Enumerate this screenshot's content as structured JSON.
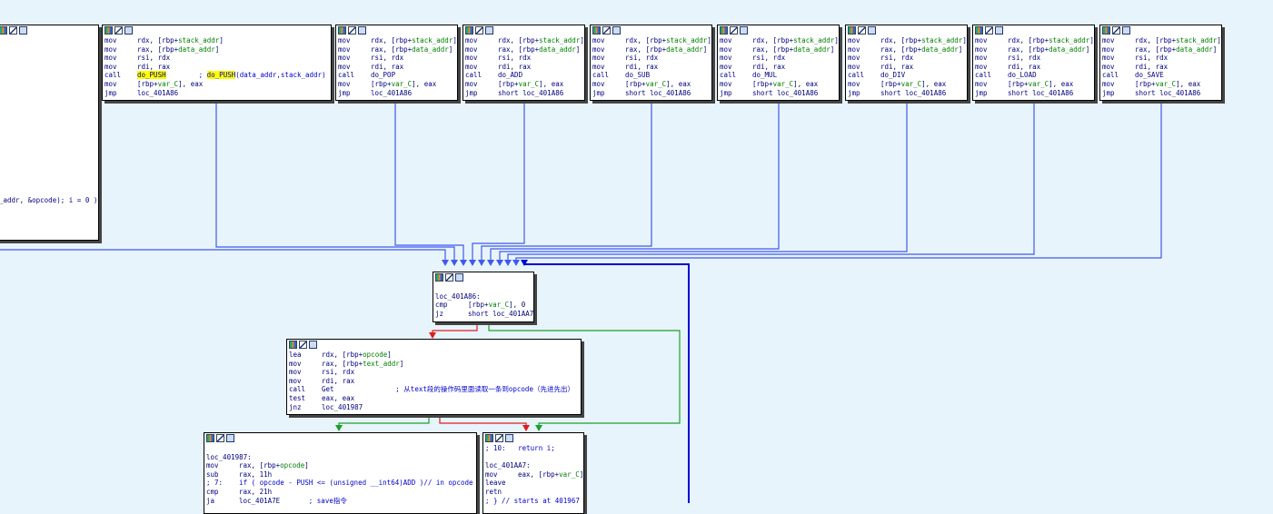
{
  "colors": {
    "background": "#e8f4fb",
    "edge_blue": "#3f59ee",
    "edge_dark_blue": "#0000d8",
    "edge_red": "#e01c1c",
    "edge_green": "#1aa02a",
    "highlight": "#ffff00"
  },
  "toolbar_icons": [
    "graph-overview-icon",
    "edit-node-icon",
    "rename-node-icon"
  ],
  "nodes": {
    "partial": {
      "lines": [
        {
          "text": "_addr, &opcode); i = 0 )"
        }
      ]
    },
    "push": {
      "lines": [
        {
          "m": "mov",
          "o": "rdx, [rbp+",
          "g": "stack_addr",
          "t": "]"
        },
        {
          "m": "mov",
          "o": "rax, [rbp+",
          "g": "data_addr",
          "t": "]"
        },
        {
          "m": "mov",
          "o": "rsi, rdx"
        },
        {
          "m": "mov",
          "o": "rdi, rax"
        },
        {
          "m": "call",
          "o": "",
          "h": "do_PUSH",
          "c": "; do_PUSH(data_addr,stack_addr)",
          "ch": "do_PUSH"
        },
        {
          "m": "mov",
          "o": "[rbp+",
          "g": "var_C",
          "t": "], eax"
        },
        {
          "m": "jmp",
          "o": "loc_401A86"
        }
      ]
    },
    "pop": {
      "lines": [
        {
          "m": "mov",
          "o": "rdx, [rbp+",
          "g": "stack_addr",
          "t": "]"
        },
        {
          "m": "mov",
          "o": "rax, [rbp+",
          "g": "data_addr",
          "t": "]"
        },
        {
          "m": "mov",
          "o": "rsi, rdx"
        },
        {
          "m": "mov",
          "o": "rdi, rax"
        },
        {
          "m": "call",
          "o": "do_POP"
        },
        {
          "m": "mov",
          "o": "[rbp+",
          "g": "var_C",
          "t": "], eax"
        },
        {
          "m": "jmp",
          "o": "loc_401A86"
        }
      ]
    },
    "add": {
      "lines": [
        {
          "m": "mov",
          "o": "rdx, [rbp+",
          "g": "stack_addr",
          "t": "]"
        },
        {
          "m": "mov",
          "o": "rax, [rbp+",
          "g": "data_addr",
          "t": "]"
        },
        {
          "m": "mov",
          "o": "rsi, rdx"
        },
        {
          "m": "mov",
          "o": "rdi, rax"
        },
        {
          "m": "call",
          "o": "do_ADD"
        },
        {
          "m": "mov",
          "o": "[rbp+",
          "g": "var_C",
          "t": "], eax"
        },
        {
          "m": "jmp",
          "o": "short loc_401A86"
        }
      ]
    },
    "sub": {
      "lines": [
        {
          "m": "mov",
          "o": "rdx, [rbp+",
          "g": "stack_addr",
          "t": "]"
        },
        {
          "m": "mov",
          "o": "rax, [rbp+",
          "g": "data_addr",
          "t": "]"
        },
        {
          "m": "mov",
          "o": "rsi, rdx"
        },
        {
          "m": "mov",
          "o": "rdi, rax"
        },
        {
          "m": "call",
          "o": "do_SUB"
        },
        {
          "m": "mov",
          "o": "[rbp+",
          "g": "var_C",
          "t": "], eax"
        },
        {
          "m": "jmp",
          "o": "short loc_401A86"
        }
      ]
    },
    "mul": {
      "lines": [
        {
          "m": "mov",
          "o": "rdx, [rbp+",
          "g": "stack_addr",
          "t": "]"
        },
        {
          "m": "mov",
          "o": "rax, [rbp+",
          "g": "data_addr",
          "t": "]"
        },
        {
          "m": "mov",
          "o": "rsi, rdx"
        },
        {
          "m": "mov",
          "o": "rdi, rax"
        },
        {
          "m": "call",
          "o": "do_MUL"
        },
        {
          "m": "mov",
          "o": "[rbp+",
          "g": "var_C",
          "t": "], eax"
        },
        {
          "m": "jmp",
          "o": "short loc_401A86"
        }
      ]
    },
    "div": {
      "lines": [
        {
          "m": "mov",
          "o": "rdx, [rbp+",
          "g": "stack_addr",
          "t": "]"
        },
        {
          "m": "mov",
          "o": "rax, [rbp+",
          "g": "data_addr",
          "t": "]"
        },
        {
          "m": "mov",
          "o": "rsi, rdx"
        },
        {
          "m": "mov",
          "o": "rdi, rax"
        },
        {
          "m": "call",
          "o": "do_DIV"
        },
        {
          "m": "mov",
          "o": "[rbp+",
          "g": "var_C",
          "t": "], eax"
        },
        {
          "m": "jmp",
          "o": "short loc_401A86"
        }
      ]
    },
    "load": {
      "lines": [
        {
          "m": "mov",
          "o": "rdx, [rbp+",
          "g": "stack_addr",
          "t": "]"
        },
        {
          "m": "mov",
          "o": "rax, [rbp+",
          "g": "data_addr",
          "t": "]"
        },
        {
          "m": "mov",
          "o": "rsi, rdx"
        },
        {
          "m": "mov",
          "o": "rdi, rax"
        },
        {
          "m": "call",
          "o": "do_LOAD"
        },
        {
          "m": "mov",
          "o": "[rbp+",
          "g": "var_C",
          "t": "], eax"
        },
        {
          "m": "jmp",
          "o": "short loc_401A86"
        }
      ]
    },
    "save": {
      "lines": [
        {
          "m": "mov",
          "o": "rdx, [rbp+",
          "g": "stack_addr",
          "t": "]"
        },
        {
          "m": "mov",
          "o": "rax, [rbp+",
          "g": "data_addr",
          "t": "]"
        },
        {
          "m": "mov",
          "o": "rsi, rdx"
        },
        {
          "m": "mov",
          "o": "rdi, rax"
        },
        {
          "m": "call",
          "o": "do_SAVE"
        },
        {
          "m": "mov",
          "o": "[rbp+",
          "g": "var_C",
          "t": "], eax"
        },
        {
          "m": "jmp",
          "o": "short loc_401A86"
        }
      ]
    },
    "loc_401a86": {
      "lines": [
        {
          "text": ""
        },
        {
          "text": "loc_401A86:"
        },
        {
          "m": "cmp",
          "o": "[rbp+",
          "g": "var_C",
          "t": "], 0"
        },
        {
          "m": "jz",
          "o": "short loc_401AA7"
        }
      ]
    },
    "get": {
      "lines": [
        {
          "m": "lea",
          "o": "rdx, [rbp+",
          "g": "opcode",
          "t": "]"
        },
        {
          "m": "mov",
          "o": "rax, [rbp+",
          "g": "text_addr",
          "t": "]"
        },
        {
          "m": "mov",
          "o": "rsi, rdx"
        },
        {
          "m": "mov",
          "o": "rdi, rax"
        },
        {
          "m": "call",
          "o": "Get",
          "c": "               ; 从text段的操作码里面读取一条到opcode（先进先出）"
        },
        {
          "m": "test",
          "o": "eax, eax"
        },
        {
          "m": "jnz",
          "o": "loc_401987"
        }
      ]
    },
    "loc_401987": {
      "lines": [
        {
          "text": ""
        },
        {
          "text": "loc_401987:"
        },
        {
          "m": "mov",
          "o": "rax, [rbp+",
          "g": "opcode",
          "t": "]"
        },
        {
          "m": "sub",
          "o": "rax, 11h"
        },
        {
          "text": "; 7:    if ( opcode - PUSH <= (unsigned __int64)ADD )// in opcode",
          "cls": "cm"
        },
        {
          "m": "cmp",
          "o": "rax, 21h"
        },
        {
          "m": "ja",
          "o": "loc_401A7E",
          "c": "       ; save指令"
        }
      ]
    },
    "ret": {
      "lines": [
        {
          "text": "; 10:   return i;",
          "cls": "cm"
        },
        {
          "text": ""
        },
        {
          "text": "loc_401AA7:"
        },
        {
          "m": "mov",
          "o": "eax, [rbp+",
          "g": "var_C",
          "t": "]"
        },
        {
          "text": "leave"
        },
        {
          "text": "retn"
        },
        {
          "text": "; } // starts at 401967",
          "cls": "cm"
        }
      ]
    }
  }
}
